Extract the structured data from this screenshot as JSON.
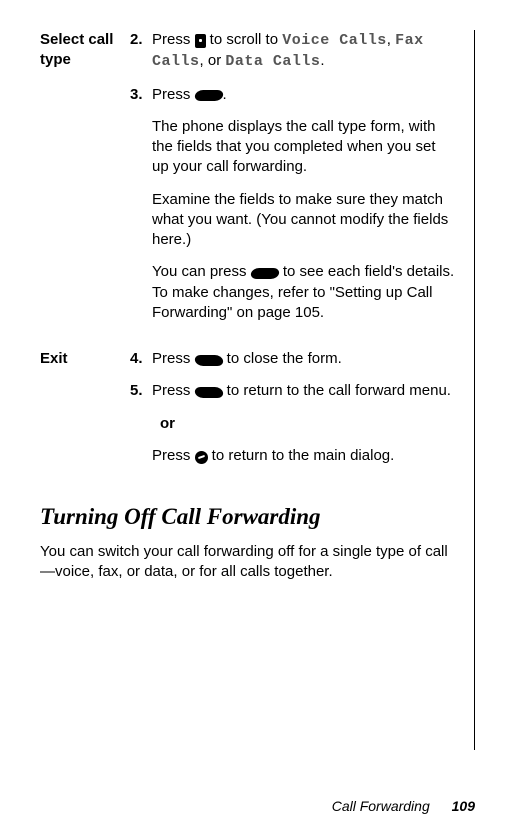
{
  "sections": {
    "selectCallType": {
      "label": "Select call type",
      "step2": {
        "num": "2.",
        "pre": "Press ",
        "mid": " to scroll to ",
        "opt1": "Voice Calls",
        "opt2": "Fax Calls",
        "opt3": "Data Calls",
        "sep": ", ",
        "orword": ", or ",
        "end": "."
      },
      "step3": {
        "num": "3.",
        "pre": "Press ",
        "end": "."
      },
      "para1": "The phone displays the call type form, with the fields that you completed when you set up your call forwarding.",
      "para2": "Examine the fields to make sure they match what you want. (You cannot modify the fields here.)",
      "para3a": "You can press ",
      "para3b": " to see each field's details. To make changes, refer to \"Setting up Call Forwarding\" on page 105."
    },
    "exit": {
      "label": "Exit",
      "step4": {
        "num": "4.",
        "pre": "Press ",
        "post": " to close the form."
      },
      "step5": {
        "num": "5.",
        "pre": "Press ",
        "post": " to return to the call forward menu."
      },
      "or": "or",
      "altA": "Press ",
      "altB": " to return to the main dialog."
    }
  },
  "heading": "Turning Off Call Forwarding",
  "bodyPara": "You can switch your call forwarding off for a single type of call—voice, fax, or data, or for all calls together.",
  "footer": {
    "title": "Call Forwarding",
    "page": "109"
  }
}
